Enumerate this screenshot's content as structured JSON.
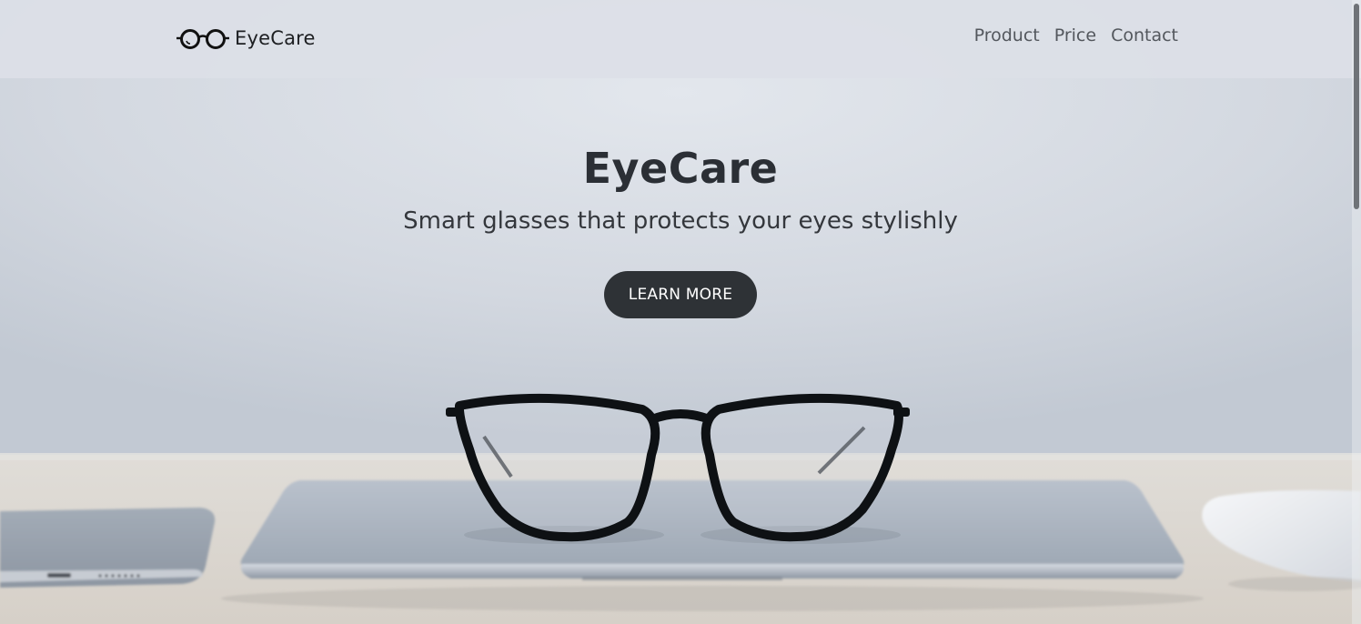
{
  "navbar": {
    "brand": {
      "icon": "glasses-icon",
      "name": "EyeCare"
    },
    "links": [
      {
        "label": "Product"
      },
      {
        "label": "Price"
      },
      {
        "label": "Contact"
      }
    ]
  },
  "hero": {
    "title": "EyeCare",
    "subtitle": "Smart glasses that protects your eyes stylishly",
    "cta_label": "LEARN MORE",
    "background_scene": "glasses-on-laptop-photo"
  },
  "colors": {
    "navbar_bg": "#dce0e7",
    "title_text": "#2b2f35",
    "button_bg": "#2e3236",
    "button_text": "#ffffff",
    "wall": "#d5dae2",
    "desk": "#dcdbd8"
  }
}
